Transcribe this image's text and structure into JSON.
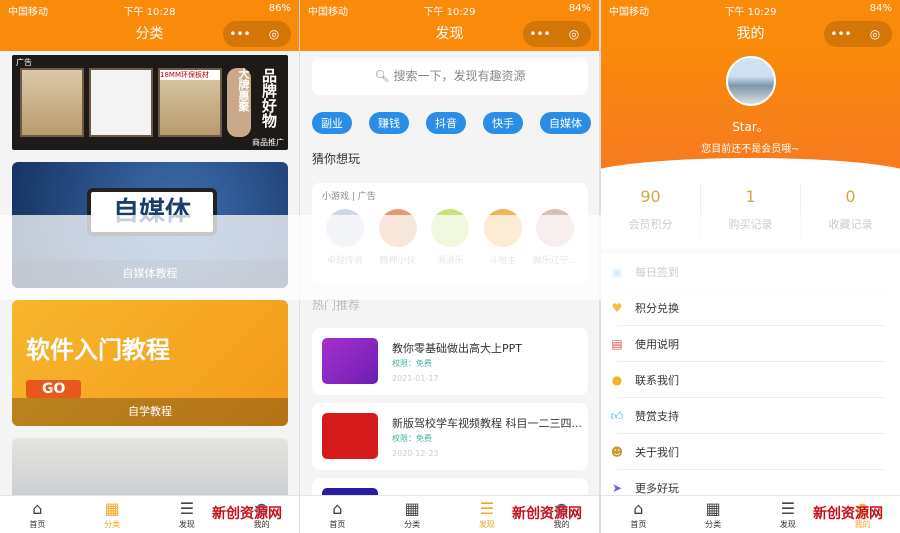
{
  "colors": {
    "accent": "#f98a0a",
    "tag": "#2b8ee6",
    "active_tab": "#f5a623"
  },
  "tabs": [
    {
      "label": "首页",
      "icon": "home-icon"
    },
    {
      "label": "分类",
      "icon": "category-icon"
    },
    {
      "label": "发现",
      "icon": "list-icon"
    },
    {
      "label": "我的",
      "icon": "user-icon"
    }
  ],
  "watermark": "新创资源网",
  "panel1": {
    "status": {
      "carrier": "中国移动",
      "time": "下午 10:28",
      "battery": "86%"
    },
    "title": "分类",
    "ad": {
      "tag": "广告",
      "texts": [
        "18MM环保板材",
        "大牌惠聚",
        "品牌好物"
      ],
      "label": "商品推广"
    },
    "cards": [
      {
        "image_text": "自媒体",
        "caption": "自媒体教程"
      },
      {
        "image_text": "软件入门教程",
        "go": "GO",
        "caption": "自学教程"
      }
    ]
  },
  "panel2": {
    "status": {
      "carrier": "中国移动",
      "time": "下午 10:29",
      "battery": "84%"
    },
    "title": "发现",
    "search_placeholder": "搜索一下，发现有趣资源",
    "tags": [
      "副业",
      "赚钱",
      "抖音",
      "快手",
      "自媒体"
    ],
    "guess_title": "猜你想玩",
    "games_header": "小游戏 | 广告",
    "games": [
      "卓越传说",
      "精神小伙",
      "消消乐",
      "斗地主",
      "微乐辽宁..."
    ],
    "hot_title": "热门推荐",
    "items": [
      {
        "title": "教你零基础做出高大上PPT",
        "perm": "权限：免费",
        "date": "2021-01-17"
      },
      {
        "title": "新版驾校学车视频教程 科目一二三四...",
        "perm": "权限：免费",
        "date": "2020-12-23"
      }
    ]
  },
  "panel3": {
    "status": {
      "carrier": "中国移动",
      "time": "下午 10:29",
      "battery": "84%"
    },
    "title": "我的",
    "user": {
      "name": "Star。",
      "subtitle": "您目前还不是会员哦~"
    },
    "stats": [
      {
        "value": "90",
        "label": "会员积分"
      },
      {
        "value": "1",
        "label": "购买记录"
      },
      {
        "value": "0",
        "label": "收藏记录"
      }
    ],
    "menu": [
      {
        "label": "每日签到",
        "icon": "calendar-icon"
      },
      {
        "label": "积分兑换",
        "icon": "gift-icon"
      },
      {
        "label": "使用说明",
        "icon": "document-icon"
      },
      {
        "label": "联系我们",
        "icon": "chat-icon"
      },
      {
        "label": "赞赏支持",
        "icon": "thumbs-up-icon"
      },
      {
        "label": "关于我们",
        "icon": "team-icon"
      },
      {
        "label": "更多好玩",
        "icon": "send-icon"
      }
    ]
  }
}
